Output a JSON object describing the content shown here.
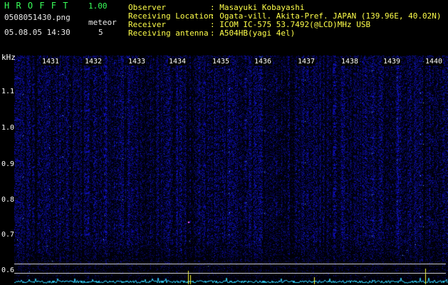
{
  "header": {
    "app_name": "H R O F F T",
    "version": "1.00",
    "filename": "0508051430.png",
    "datetime": "05.08.05 14:30",
    "meteor_label": "meteor",
    "meteor_count": "5"
  },
  "info": {
    "rows": [
      {
        "label": "Observer",
        "value": ": Masayuki Kobayashi"
      },
      {
        "label": "Receiving Location",
        "value": ": Ogata-vill. Akita-Pref. JAPAN (139.96E, 40.02N)"
      },
      {
        "label": "Receiver",
        "value": ": ICOM IC-575 53.7492(@LCD)MHz USB"
      },
      {
        "label": "Receiving antenna",
        "value": ": A504HB(yagi 4el)"
      }
    ]
  },
  "spectrogram": {
    "unit_label": "kHz",
    "time_ticks": [
      "1431",
      "1432",
      "1433",
      "1434",
      "1435",
      "1436",
      "1437",
      "1438",
      "1439",
      "1440"
    ],
    "freq_ticks": [
      "1.1",
      "1.0",
      "0.9",
      "0.8",
      "0.7",
      "0.6"
    ],
    "colors": {
      "background": "#000010",
      "signal": "#1a2cff",
      "trace": "#35d8ff",
      "spike": "#ffff30"
    }
  }
}
